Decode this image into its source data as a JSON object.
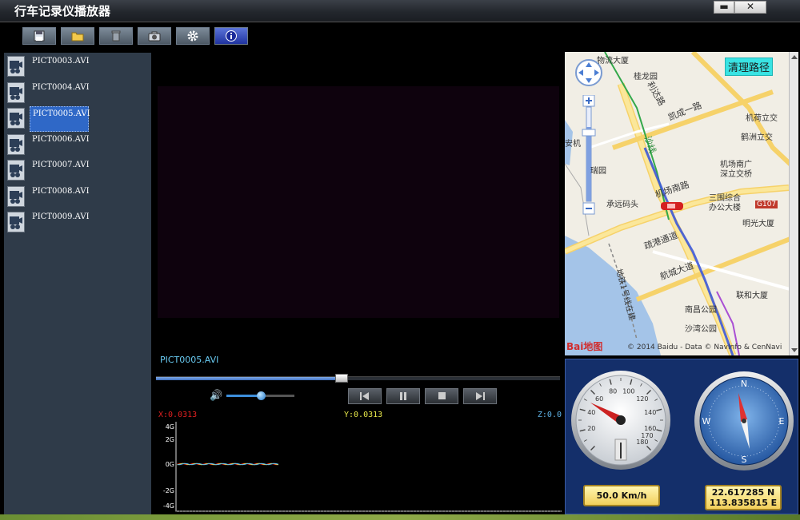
{
  "window": {
    "title": "行车记录仪播放器",
    "minimize_label": "▬",
    "close_label": "✕"
  },
  "toolbar": {
    "buttons": [
      "save-icon",
      "folder-icon",
      "trash-icon",
      "camera-icon",
      "gear-icon",
      "info-icon"
    ]
  },
  "file_list": {
    "items": [
      "PICT0003.AVI",
      "PICT0004.AVI",
      "PICT0005.AVI",
      "PICT0006.AVI",
      "PICT0007.AVI",
      "PICT0008.AVI",
      "PICT0009.AVI"
    ],
    "selected": "PICT0005.AVI"
  },
  "player": {
    "now_playing": "PICT0005.AVI",
    "progress": 0.46,
    "volume": 0.5,
    "controls": [
      "previous-icon",
      "pause-icon",
      "stop-icon",
      "next-icon"
    ]
  },
  "gsensor": {
    "x": "X:0.0313",
    "y": "Y:0.0313",
    "z": "Z:0.0",
    "axis_labels": [
      "4G",
      "2G",
      "0G",
      "-2G",
      "-4G"
    ]
  },
  "map": {
    "clear_route_label": "清理路径",
    "labels": {
      "l1": "物流大厦",
      "l2": "桂龙园",
      "l3": "利达路",
      "l4": "凯成一路",
      "l5": "机荷立交",
      "l6": "鹤洲立交",
      "l7": "安机",
      "l8": "机场南广",
      "l9": "深立交桥",
      "l10": "承远码头",
      "l11": "机场南路",
      "l12": "三围综合",
      "l13": "办公大楼",
      "l14": "G107",
      "l15": "明光大厦",
      "l16": "疏港通道",
      "l17": "航城大道",
      "l18": "联和大厦",
      "l19": "南昌公园",
      "l20": "沙湾公园",
      "l21": "地铁1号线在建",
      "l22": "沙线",
      "l23": "瑞园"
    },
    "baidu_logo": "Bai地图",
    "copyright": "© 2014 Baidu - Data © NavInfo & CenNavi"
  },
  "gauges": {
    "speed": {
      "value": 50,
      "readout": "50.0 Km/h",
      "ticks": [
        "20",
        "40",
        "60",
        "80",
        "100",
        "120",
        "140",
        "160",
        "170",
        "180"
      ]
    },
    "compass": {
      "n": "N",
      "e": "E",
      "s": "S",
      "w": "W"
    },
    "coords": {
      "lat": "22.617285 N",
      "lon": "113.835815 E"
    }
  },
  "colors": {
    "accent": "#2f68c7",
    "x_axis": "#e02020",
    "y_axis": "#e8e84a",
    "z_axis": "#5fb3e8",
    "readout": "#f2cf5b"
  }
}
